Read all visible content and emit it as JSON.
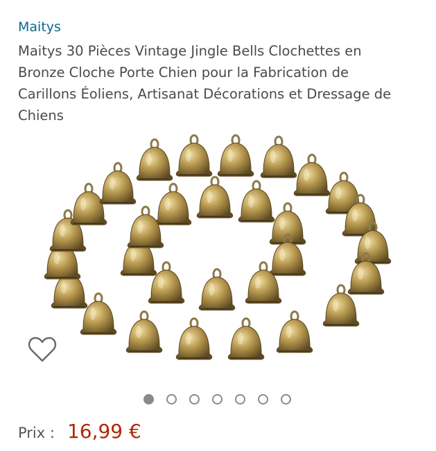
{
  "product": {
    "brand": "Maitys",
    "title": "Maitys 30 Pièces Vintage Jingle Bells Clochettes en Bronze Cloche Porte Chien pour la Fabrication de Carillons Éoliens, Artisanat Décorations et Dressage de Chiens",
    "title_lines": [
      "Maitys 30 Pièces Vintage Jingle Bells Clochettes en",
      "Bronze Cloche Porte Chien pour la Fabrication de",
      "Carillons Éoliens, Artisanat Décorations et Dressage de",
      "Chiens"
    ],
    "price_label": "Prix :",
    "price_value": "16,99 €"
  },
  "gallery": {
    "image_count": 7,
    "active_index": 0
  },
  "icons": {
    "wishlist": "heart-outline-icon"
  },
  "colors": {
    "brand_link": "#0a6a8e",
    "price": "#b12704",
    "bell_bronze": "#b89a56"
  }
}
